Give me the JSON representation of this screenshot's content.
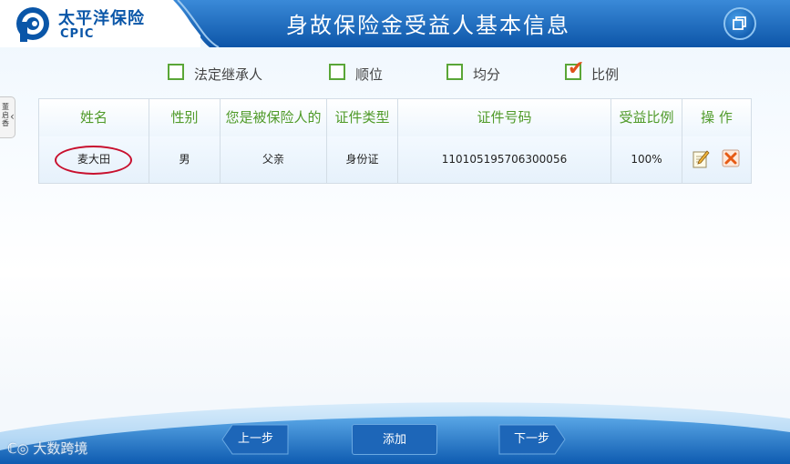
{
  "header": {
    "brand_cn": "太平洋保险",
    "brand_en": "CPIC",
    "title": "身故保险金受益人基本信息",
    "window_icon": "restore-window-icon",
    "colors": {
      "band": "#1565b8",
      "band_light": "#3a8ad8",
      "brand": "#0a56a8"
    }
  },
  "side_tab": {
    "label": "董启香"
  },
  "options": [
    {
      "label": "法定继承人",
      "checked": false
    },
    {
      "label": "顺位",
      "checked": false
    },
    {
      "label": "均分",
      "checked": false
    },
    {
      "label": "比例",
      "checked": true
    }
  ],
  "table": {
    "headers": [
      "姓名",
      "性别",
      "您是被保险人的",
      "证件类型",
      "证件号码",
      "受益比例",
      "操 作"
    ],
    "rows": [
      {
        "name": "麦大田",
        "gender": "男",
        "relation": "父亲",
        "id_type": "身份证",
        "id_number": "110105195706300056",
        "ratio": "100%"
      }
    ],
    "actions": [
      "edit-icon",
      "delete-icon"
    ],
    "header_color": "#4f9a28",
    "highlight_color": "#c8102e"
  },
  "footer": {
    "prev": "上一步",
    "add": "添加",
    "next": "下一步",
    "watermark": "大数跨境"
  }
}
